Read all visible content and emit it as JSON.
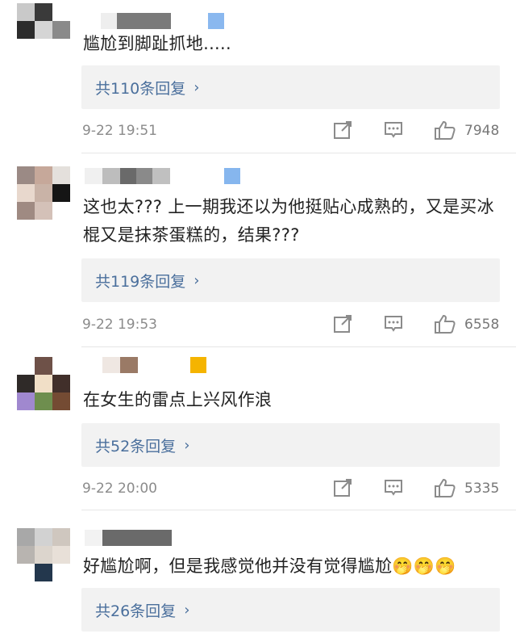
{
  "comments": [
    {
      "text": "尴尬到脚趾抓地.....",
      "reply_label": "共110条回复",
      "reply_chevron": "›",
      "time": "9-22 19:51",
      "likes": "7948",
      "badge_color": "#8ab8ef",
      "avatar_colors": [
        "#c9c9c9",
        "#3a3a3a",
        "#ffffff",
        "#2c2c2c",
        "#d5d5d5",
        "#8a8a8a",
        "#ffffff",
        "#ffffff",
        "#ffffff"
      ],
      "name_colors": [
        "#ffffff",
        "#eeeeee",
        "#7a7a7a",
        "#7a7a7a"
      ]
    },
    {
      "text": "这也太??? 上一期我还以为他挺贴心成熟的，又是买冰棍又是抹茶蛋糕的，结果???",
      "reply_label": "共119条回复",
      "reply_chevron": "›",
      "time": "9-22 19:53",
      "likes": "6558",
      "badge_color": "#86b6ee",
      "avatar_colors": [
        "#9b8a85",
        "#c6a89a",
        "#e4e0dc",
        "#e8d8cd",
        "#c9b3a7",
        "#151515",
        "#9f8a82",
        "#d4c1b8",
        "#ffffff"
      ],
      "name_colors": [
        "#f0f0f0",
        "#bdbdbd",
        "#6a6a6a",
        "#8a8a8a",
        "#c0c0c0"
      ]
    },
    {
      "text": "在女生的雷点上兴风作浪",
      "reply_label": "共52条回复",
      "reply_chevron": "›",
      "time": "9-22 20:00",
      "likes": "5335",
      "badge_color": "#f5b400",
      "avatar_colors": [
        "#ffffff",
        "#6e5148",
        "#ffffff",
        "#2f2a28",
        "#f1dfc7",
        "#412f2a",
        "#a088cf",
        "#6e8e4e",
        "#744b33"
      ],
      "name_colors": [
        "#ffffff",
        "#efe7e2",
        "#9a7a66"
      ]
    },
    {
      "text": "好尴尬啊，但是我感觉他并没有觉得尴尬🤭🤭🤭",
      "reply_label": "共26条回复",
      "reply_chevron": "›",
      "time": "",
      "likes": "",
      "badge_color": "",
      "avatar_colors": [
        "#a8a8a8",
        "#d2d2d2",
        "#cfc7bf",
        "#b8b4b0",
        "#dcd5cd",
        "#e8e0d8",
        "#ffffff",
        "#23374d",
        "#ffffff"
      ],
      "name_colors": [
        "#f2f2f2",
        "#6a6a6a"
      ]
    }
  ]
}
